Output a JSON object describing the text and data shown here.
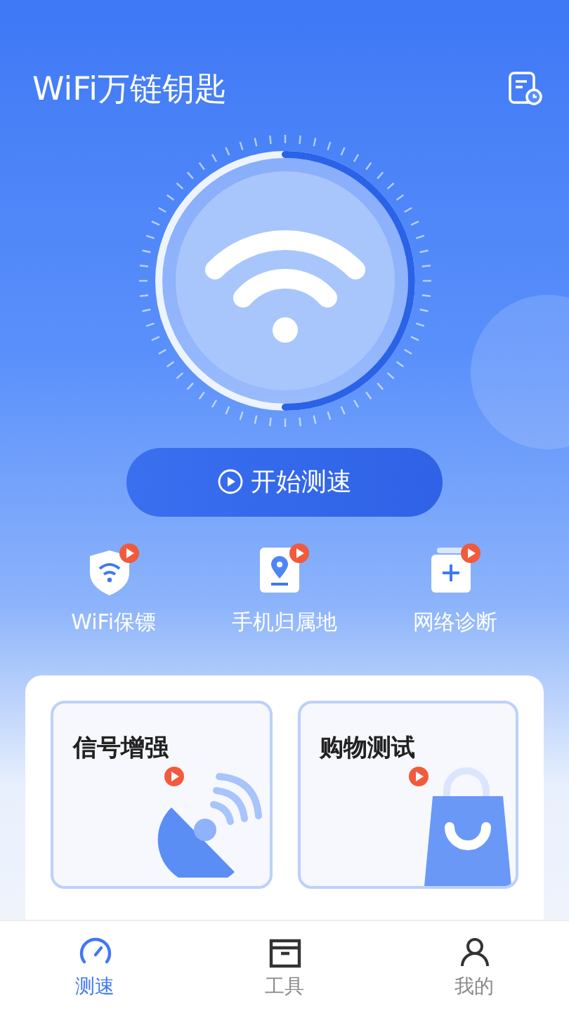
{
  "header": {
    "title": "WiFi万链钥匙"
  },
  "speed_test": {
    "button": "开始测速"
  },
  "tools": [
    {
      "kind": "shield",
      "label": "WiFi保镖"
    },
    {
      "kind": "location",
      "label": "手机归属地"
    },
    {
      "kind": "medkit",
      "label": "网络诊断"
    }
  ],
  "feature_cards": [
    {
      "kind": "signal",
      "title": "信号增强"
    },
    {
      "kind": "shopping",
      "title": "购物测试"
    }
  ],
  "tab_bar": [
    {
      "kind": "gauge",
      "label": "测速",
      "selected": true
    },
    {
      "kind": "box",
      "label": "工具",
      "selected": false
    },
    {
      "kind": "person",
      "label": "我的",
      "selected": false
    }
  ]
}
